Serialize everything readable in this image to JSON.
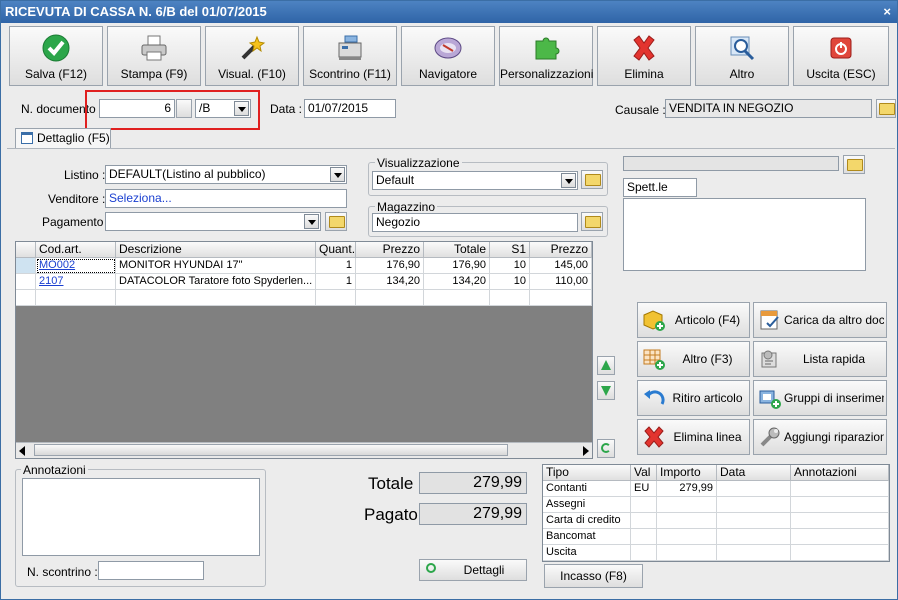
{
  "window": {
    "title": "RICEVUTA DI CASSA N. 6/B del 01/07/2015",
    "close": "×"
  },
  "toolbar": [
    {
      "label": "Salva (F12)",
      "icon": "check-icon"
    },
    {
      "label": "Stampa (F9)",
      "icon": "printer-icon"
    },
    {
      "label": "Visual. (F10)",
      "icon": "magic-wand-icon"
    },
    {
      "label": "Scontrino (F11)",
      "icon": "cash-register-icon"
    },
    {
      "label": "Navigatore",
      "icon": "compass-icon"
    },
    {
      "label": "Personalizzazioni",
      "icon": "puzzle-icon"
    },
    {
      "label": "Elimina",
      "icon": "delete-x-icon"
    },
    {
      "label": "Altro",
      "icon": "search-icon"
    },
    {
      "label": "Uscita (ESC)",
      "icon": "power-icon"
    }
  ],
  "header": {
    "ndoc_label": "N. documento :",
    "ndoc_value": "6",
    "ndoc_suffix": "/B",
    "data_label": "Data :",
    "data_value": "01/07/2015",
    "causale_label": "Causale :",
    "causale_value": "VENDITA IN NEGOZIO"
  },
  "tab": {
    "label": "Dettaglio (F5)"
  },
  "form": {
    "listino_label": "Listino :",
    "listino_value": "DEFAULT(Listino al pubblico)",
    "venditore_label": "Venditore :",
    "venditore_value": "Seleziona...",
    "pagamento_label": "Pagamento :",
    "pagamento_value": "",
    "visualizzazione_label": "Visualizzazione",
    "visualizzazione_value": "Default",
    "magazzino_label": "Magazzino",
    "magazzino_value": "Negozio",
    "cliente_value": "",
    "spett_value": "Spett.le",
    "address_value": ""
  },
  "grid": {
    "columns": [
      "Cod.art.",
      "Descrizione",
      "Quant.",
      "Prezzo",
      "Totale",
      "S1",
      "Prezzo"
    ],
    "rows": [
      [
        "MO002",
        "MONITOR HYUNDAI 17\"",
        "1",
        "176,90",
        "176,90",
        "10",
        "145,00"
      ],
      [
        "2107",
        "DATACOLOR Taratore foto Spyderlen...",
        "1",
        "134,20",
        "134,20",
        "10",
        "110,00"
      ],
      [
        "",
        "",
        "",
        "",
        "",
        "",
        ""
      ]
    ]
  },
  "actions": [
    {
      "label": "Articolo (F4)",
      "icon": "box-add-icon"
    },
    {
      "label": "Carica da altro doc.",
      "icon": "doc-check-icon"
    },
    {
      "label": "Altro (F3)",
      "icon": "grid-add-icon"
    },
    {
      "label": "Lista rapida",
      "icon": "list-quick-icon"
    },
    {
      "label": "Ritiro articolo",
      "icon": "return-arrow-icon"
    },
    {
      "label": "Gruppi di inserimento",
      "icon": "group-add-icon"
    },
    {
      "label": "Elimina linea",
      "icon": "delete-x-icon"
    },
    {
      "label": "Aggiungi riparazione",
      "icon": "wrench-icon"
    }
  ],
  "annotazioni": {
    "label": "Annotazioni",
    "value": "",
    "scontrino_label": "N. scontrino :",
    "scontrino_value": ""
  },
  "totals": {
    "totale_label": "Totale",
    "totale_value": "279,99",
    "pagato_label": "Pagato",
    "pagato_value": "279,99",
    "dettagli_label": "Dettagli"
  },
  "payments": {
    "columns": [
      "Tipo",
      "Val",
      "Importo",
      "Data",
      "Annotazioni"
    ],
    "rows": [
      [
        "Contanti",
        "EU",
        "279,99",
        "",
        ""
      ],
      [
        "Assegni",
        "",
        "",
        "",
        ""
      ],
      [
        "Carta di credito",
        "",
        "",
        "",
        ""
      ],
      [
        "Bancomat",
        "",
        "",
        "",
        ""
      ],
      [
        "Uscita",
        "",
        "",
        "",
        ""
      ]
    ],
    "incasso_label": "Incasso (F8)"
  },
  "colors": {
    "highlight": "#e02020",
    "link": "#1a3fd0"
  }
}
